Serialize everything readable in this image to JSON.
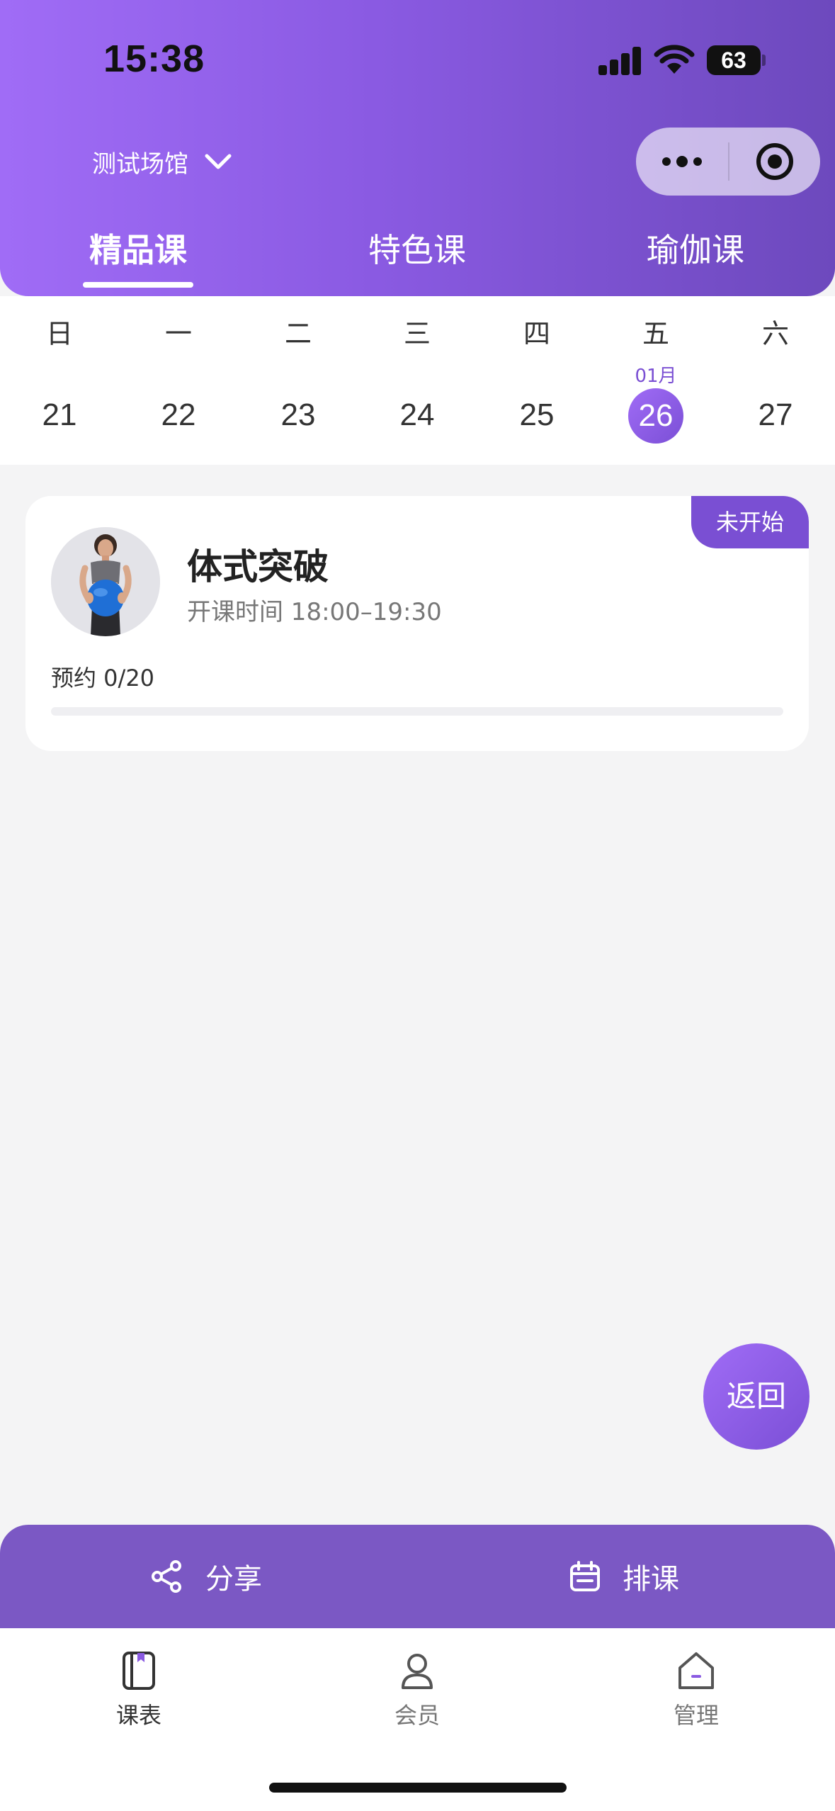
{
  "status_bar": {
    "time": "15:38",
    "battery": "63"
  },
  "header": {
    "venue": "测试场馆",
    "tabs": [
      {
        "label": "精品课",
        "active": true
      },
      {
        "label": "特色课",
        "active": false
      },
      {
        "label": "瑜伽课",
        "active": false
      }
    ]
  },
  "calendar": {
    "month_label": "01月",
    "days": [
      {
        "weekday": "日",
        "date": "21"
      },
      {
        "weekday": "一",
        "date": "22"
      },
      {
        "weekday": "二",
        "date": "23"
      },
      {
        "weekday": "三",
        "date": "24"
      },
      {
        "weekday": "四",
        "date": "25"
      },
      {
        "weekday": "五",
        "date": "26",
        "selected": true
      },
      {
        "weekday": "六",
        "date": "27"
      }
    ]
  },
  "course": {
    "title": "体式突破",
    "time": "开课时间 18:00–19:30",
    "booking": "预约 0/20",
    "booked_fraction": 0,
    "status": "未开始"
  },
  "back_button": "返回",
  "actions": {
    "share": "分享",
    "schedule": "排课"
  },
  "tabbar": {
    "items": [
      {
        "label": "课表",
        "icon": "book-icon",
        "active": true
      },
      {
        "label": "会员",
        "icon": "member-icon",
        "active": false
      },
      {
        "label": "管理",
        "icon": "home-icon",
        "active": false
      }
    ]
  },
  "colors": {
    "accent": "#7a4fd3",
    "accent_light": "#a06cf6",
    "action_bar": "#7b58c4"
  }
}
